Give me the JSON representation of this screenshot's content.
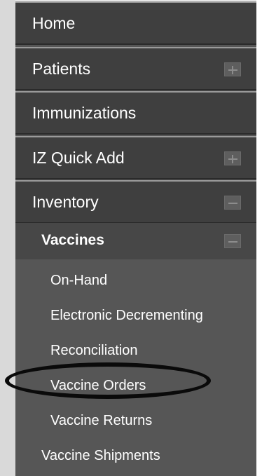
{
  "menu": {
    "top_items": [
      {
        "label": "Home",
        "toggle": null
      },
      {
        "label": "Patients",
        "toggle": "expand"
      },
      {
        "label": "Immunizations",
        "toggle": null
      },
      {
        "label": "IZ Quick Add",
        "toggle": "expand"
      },
      {
        "label": "Inventory",
        "toggle": "collapse"
      }
    ],
    "vaccines": {
      "label": "Vaccines",
      "toggle": "collapse",
      "items": [
        {
          "label": "On-Hand"
        },
        {
          "label": "Electronic Decrementing"
        },
        {
          "label": "Reconciliation"
        },
        {
          "label": "Vaccine Orders",
          "circled": true
        },
        {
          "label": "Vaccine Returns"
        }
      ]
    },
    "inventory_items": [
      {
        "label": "Vaccine Shipments"
      }
    ]
  }
}
